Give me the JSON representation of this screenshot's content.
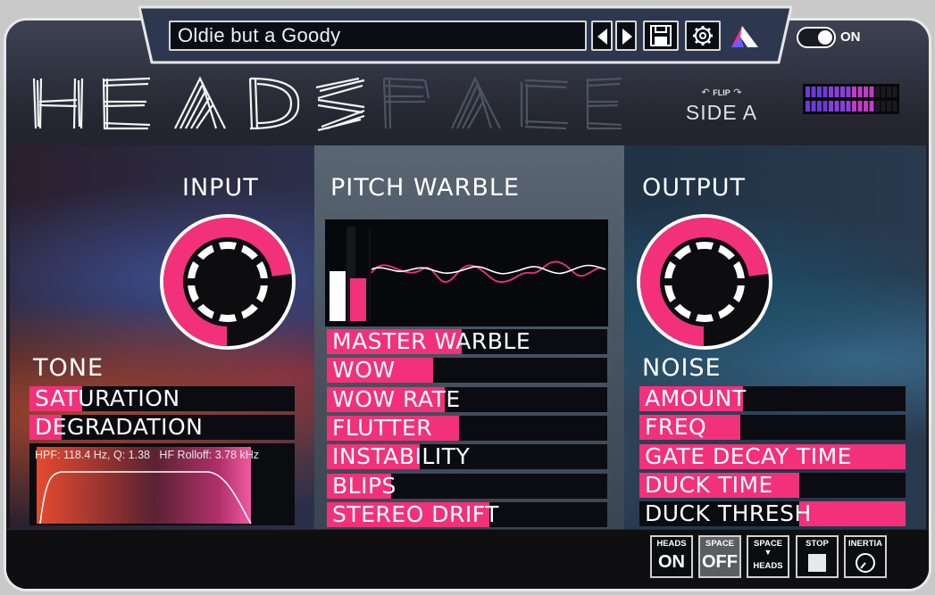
{
  "preset": {
    "name": "Oldie but a Goody"
  },
  "toolbar": {
    "prev_label": "previous-preset",
    "next_label": "next-preset",
    "save_icon": "save-icon",
    "settings_icon": "gear-icon",
    "brand_icon": "brand-logo-icon"
  },
  "power": {
    "label": "ON"
  },
  "logo": {
    "text": "HEADSPACE"
  },
  "side": {
    "flip_label": "FLIP",
    "label": "SIDE A"
  },
  "colors": {
    "accent": "#f2317a",
    "bg_dark": "#0b0c12",
    "meter_purple": "#9b3fe0"
  },
  "sections": {
    "input": {
      "title": "INPUT",
      "level": 0.73
    },
    "pitch_warble": {
      "title": "PITCH WARBLE"
    },
    "output": {
      "title": "OUTPUT",
      "level": 0.73
    },
    "tone": {
      "title": "TONE"
    },
    "noise": {
      "title": "NOISE"
    }
  },
  "tone_params": [
    {
      "label": "SATURATION",
      "value": 0.2
    },
    {
      "label": "DEGRADATION",
      "value": 0.12
    }
  ],
  "warble_params": [
    {
      "label": "MASTER WARBLE",
      "value": 0.48
    },
    {
      "label": "WOW",
      "value": 0.38
    },
    {
      "label": "WOW RATE",
      "value": 0.42
    },
    {
      "label": "FLUTTER",
      "value": 0.47
    },
    {
      "label": "INSTABILITY",
      "value": 0.33
    },
    {
      "label": "BLIPS",
      "value": 0.23
    },
    {
      "label": "STEREO DRIFT",
      "value": 0.58
    }
  ],
  "noise_params": [
    {
      "label": "AMOUNT",
      "value": 0.39
    },
    {
      "label": "FREQ",
      "value": 0.38
    },
    {
      "label": "GATE DECAY TIME",
      "value": 1.0
    },
    {
      "label": "DUCK TIME",
      "value": 0.6
    },
    {
      "label": "DUCK THRESH",
      "value": 0.4,
      "fill_from_right": true
    }
  ],
  "filter": {
    "hpf_text": "HPF: 118.4 Hz, Q: 1.38",
    "rolloff_text": "HF Rolloff: 3.78 kHz"
  },
  "bottom_buttons": [
    {
      "caption": "HEADS",
      "value": "ON",
      "active": false
    },
    {
      "caption": "SPACE",
      "value": "OFF",
      "active": true
    },
    {
      "caption": "SPACE",
      "value": "HEADS",
      "arrow": true,
      "active": false
    },
    {
      "caption": "STOP",
      "value": "",
      "active": false
    },
    {
      "caption": "INERTIA",
      "value": "",
      "active": false
    }
  ]
}
